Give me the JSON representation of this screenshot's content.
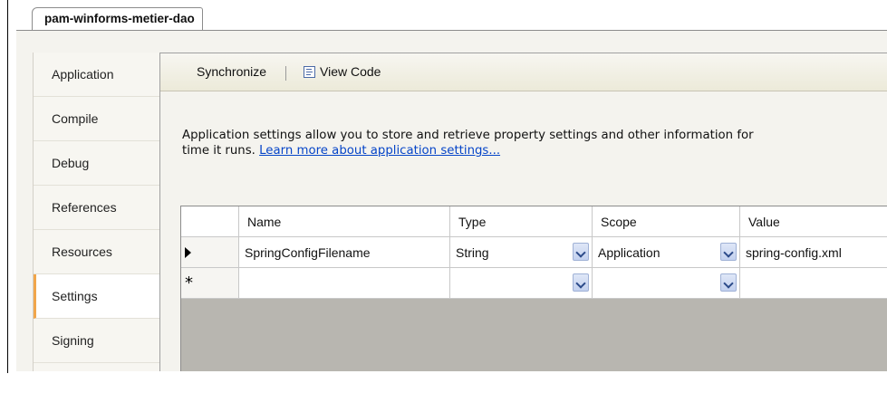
{
  "document_tab": {
    "label": "pam-winforms-metier-dao"
  },
  "side_tabs": [
    {
      "label": "Application",
      "active": false
    },
    {
      "label": "Compile",
      "active": false
    },
    {
      "label": "Debug",
      "active": false
    },
    {
      "label": "References",
      "active": false
    },
    {
      "label": "Resources",
      "active": false
    },
    {
      "label": "Settings",
      "active": true
    },
    {
      "label": "Signing",
      "active": false
    }
  ],
  "toolbar": {
    "synchronize_label": "Synchronize",
    "view_code_label": "View Code",
    "view_code_icon": "view-code-icon"
  },
  "description": {
    "line1": "Application settings allow you to store and retrieve property settings and other information for",
    "line2_prefix": "time it runs. ",
    "link_text": "Learn more about application settings..."
  },
  "grid": {
    "columns": [
      "Name",
      "Type",
      "Scope",
      "Value"
    ],
    "rows": [
      {
        "indicator": "current-row-arrow",
        "name": "SpringConfigFilename",
        "type": "String",
        "scope": "Application",
        "value": "spring-config.xml"
      },
      {
        "indicator": "new-row-star",
        "indicator_text": "*",
        "name": "",
        "type": "",
        "scope": "",
        "value": ""
      }
    ]
  },
  "colors": {
    "active_tab_accent": "#f1a64b",
    "link": "#0645c8",
    "panel_bg": "#f4f3ee",
    "grid_bg": "#b8b6b0"
  }
}
